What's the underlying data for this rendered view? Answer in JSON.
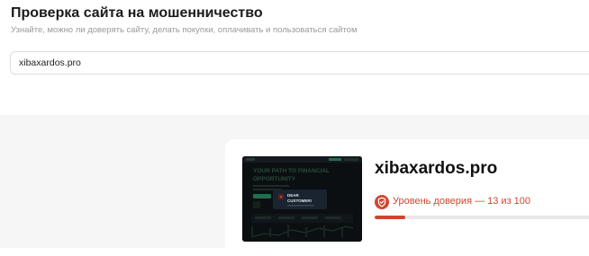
{
  "header": {
    "title": "Проверка сайта на мошенничество",
    "subtitle": "Узнайте, можно ли доверять сайту, делать покупки, оплачивать и пользоваться сайтом"
  },
  "search": {
    "value": "xibaxardos.pro"
  },
  "result": {
    "domain": "xibaxardos.pro",
    "trust_label": "Уровень доверия — 13 из 100",
    "trust_score": 13,
    "trust_max": 100,
    "status_color": "#d1452f",
    "status_icon": "shield-warning-icon",
    "thumbnail": {
      "headline": "YOUR PATH TO FINANCIAL OPPORTUNITY",
      "popup_text": "DEAR CUSTOMER!"
    }
  }
}
